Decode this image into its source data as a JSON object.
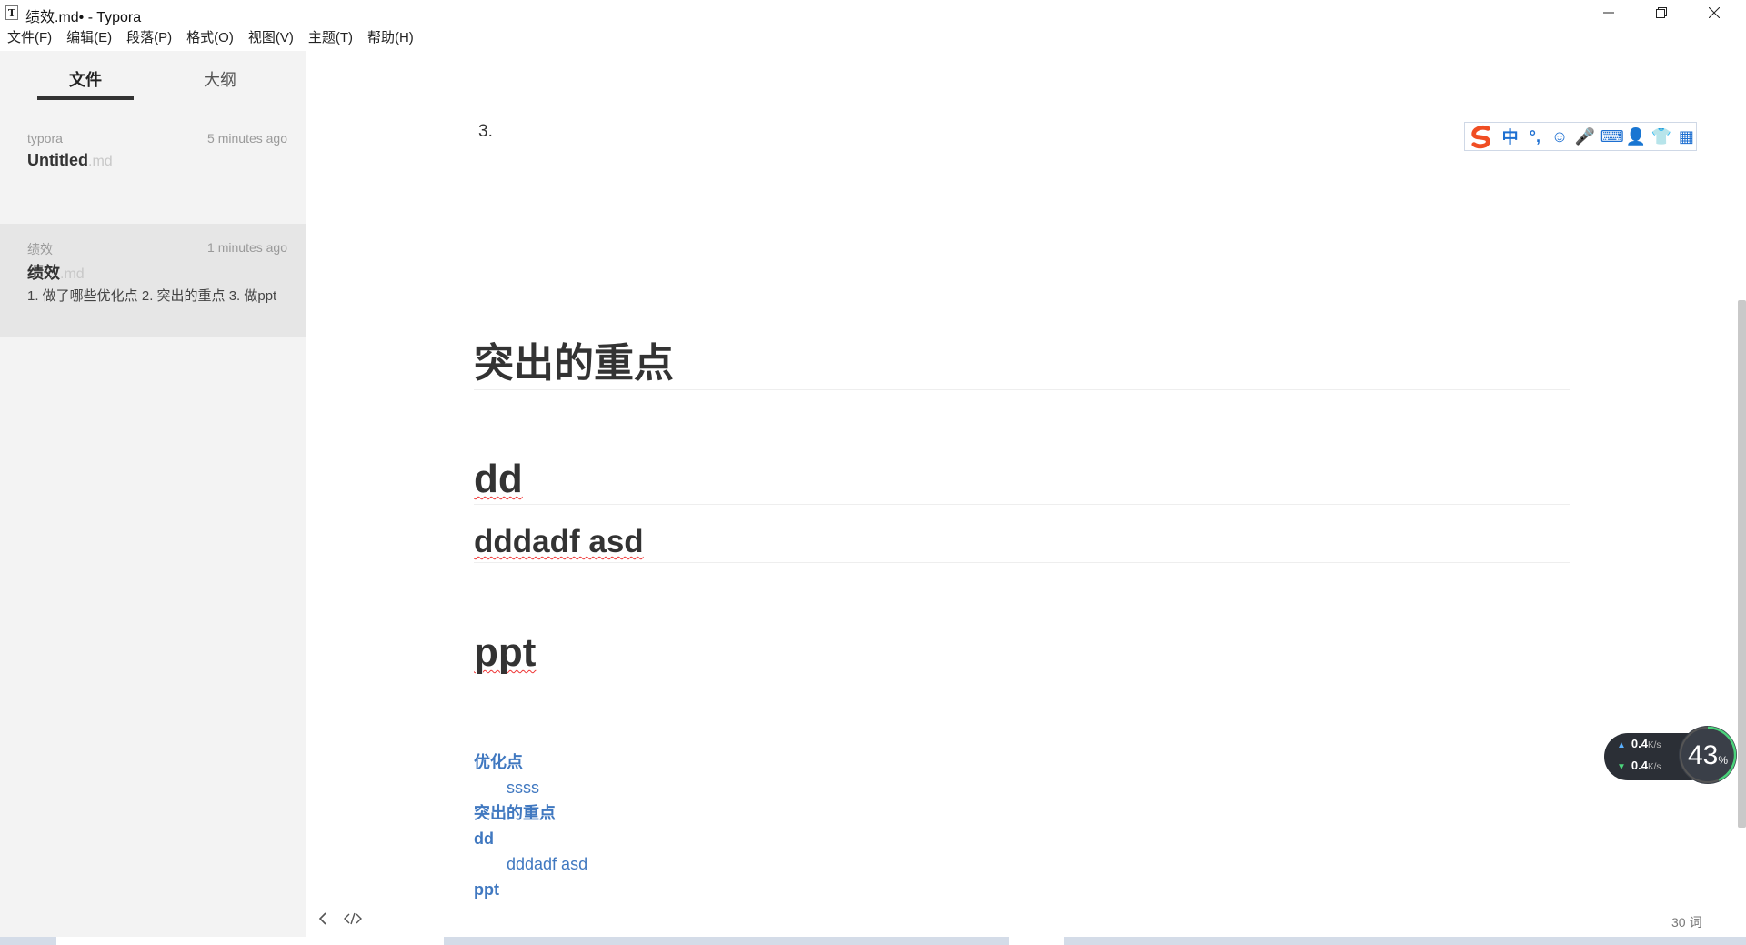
{
  "window": {
    "title": "绩效.md• - Typora",
    "app_icon": "T"
  },
  "menu": [
    "文件(F)",
    "编辑(E)",
    "段落(P)",
    "格式(O)",
    "视图(V)",
    "主题(T)",
    "帮助(H)"
  ],
  "sidebar": {
    "tabs": {
      "files": "文件",
      "outline": "大纲"
    },
    "files": [
      {
        "folder": "typora",
        "time": "5 minutes ago",
        "name": "Untitled",
        "ext": ".md",
        "preview": ""
      },
      {
        "folder": "绩效",
        "time": "1 minutes ago",
        "name": "绩效",
        "ext": ".md",
        "preview": "1. 做了哪些优化点 2. 突出的重点 3. 做ppt"
      }
    ]
  },
  "editor": {
    "list_number": "3.",
    "headings": [
      "突出的重点",
      "dd",
      "dddadf asd",
      "ppt"
    ],
    "toc": [
      {
        "label": "优化点",
        "level": 1
      },
      {
        "label": "ssss",
        "level": 2
      },
      {
        "label": "突出的重点",
        "level": 1
      },
      {
        "label": "dd",
        "level": 1
      },
      {
        "label": "dddadf asd",
        "level": 2
      },
      {
        "label": "ppt",
        "level": 1
      }
    ]
  },
  "ime": {
    "buttons": [
      "中",
      "°,",
      "☺",
      "🎤",
      "⌨",
      "👤",
      "👕",
      "▦"
    ]
  },
  "net_widget": {
    "up": "0.4",
    "down": "0.4",
    "unit": "K/s",
    "percent": "43",
    "percent_sign": "%"
  },
  "status": {
    "word_count": "30 词"
  },
  "colors": {
    "link": "#4078c0",
    "sidebar_bg": "#f3f3f3",
    "selected_bg": "#e6e6e6"
  }
}
